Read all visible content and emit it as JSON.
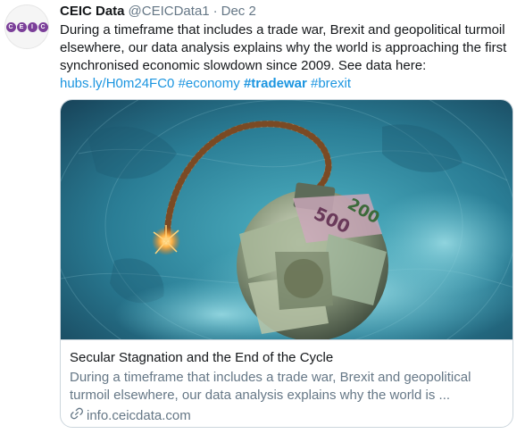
{
  "author": {
    "name": "CEIC Data",
    "handle": "@CEICData1",
    "separator": "·",
    "date": "Dec 2",
    "avatar_letters": [
      "C",
      "E",
      "I",
      "C"
    ]
  },
  "tweet": {
    "lines": [
      "During a timeframe that includes a trade war, Brexit and geopolitical turmoil",
      "elsewhere, our data analysis explains why the world is approaching the first",
      "synchronised economic slowdown since 2009. See data here:"
    ],
    "link": "hubs.ly/H0m24FC0",
    "hashtags": [
      "#economy",
      "#tradewar",
      "#brexit"
    ]
  },
  "card": {
    "title": "Secular Stagnation and the End of the Cycle",
    "description_lines": [
      "During a timeframe that includes a trade war, Brexit and geopolitical",
      "turmoil elsewhere, our data analysis explains why the world is ..."
    ],
    "domain": "info.ceicdata.com",
    "icon": "link-icon",
    "image_labels": [
      "500",
      "200"
    ]
  },
  "colors": {
    "link": "#1b95e0",
    "secondary": "#657786",
    "brand": "#7b3f99"
  }
}
